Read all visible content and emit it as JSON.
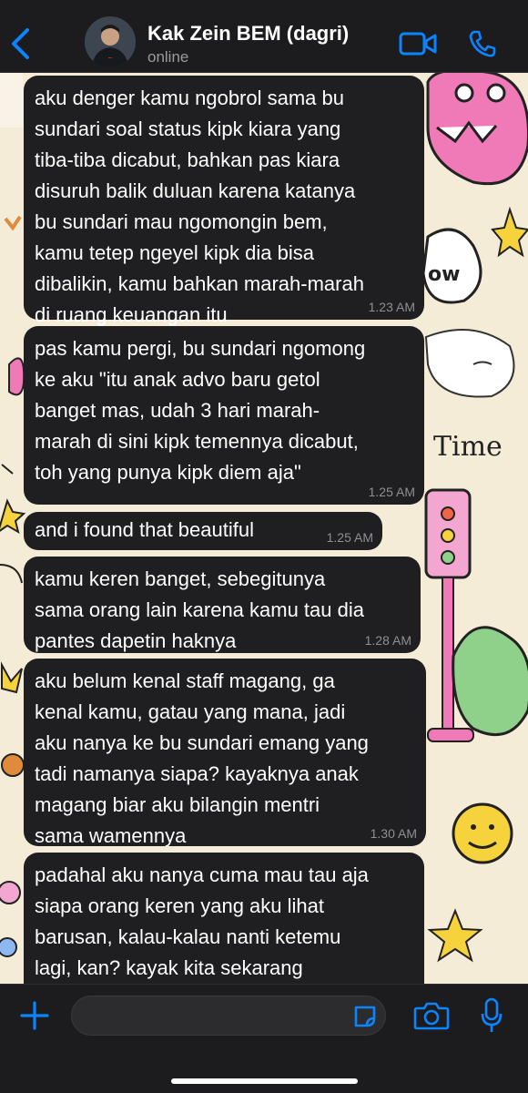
{
  "header": {
    "back_icon": "chevron-left-icon",
    "contact_name": "Kak Zein BEM (dagri)",
    "status": "online",
    "video_icon": "video-camera-icon",
    "phone_icon": "phone-icon",
    "accent": "#0a84ff"
  },
  "messages": [
    {
      "text": "aku denger kamu ngobrol sama bu\nsundari soal status kipk kiara yang\ntiba-tiba dicabut, bahkan pas kiara\ndisuruh balik duluan karena katanya\nbu sundari mau ngomongin bem,\nkamu tetep ngeyel kipk dia bisa\ndibalikin, kamu bahkan marah-marah\ndi ruang keuangan itu",
      "time": "1.23 AM"
    },
    {
      "text": "pas kamu pergi, bu sundari ngomong\nke aku \"itu anak advo baru getol\nbanget mas, udah 3 hari marah-\nmarah di sini kipk temennya dicabut,\ntoh yang punya kipk diem aja\"",
      "time": "1.25 AM"
    },
    {
      "text": "and i found that beautiful",
      "time": "1.25 AM"
    },
    {
      "text": "kamu keren banget, sebegitunya\nsama orang lain karena kamu tau dia\npantes dapetin haknya",
      "time": "1.28 AM"
    },
    {
      "text": "aku belum kenal staff magang, ga\nkenal kamu, gatau yang mana, jadi\naku nanya ke bu sundari emang yang\ntadi namanya siapa? kayaknya anak\nmagang biar aku bilangin mentri\nsama wamennya",
      "time": "1.30 AM"
    },
    {
      "text": "padahal aku nanya cuma mau tau aja\nsiapa orang keren yang aku lihat\nbarusan, kalau-kalau nanti ketemu\nlagi, kan? kayak kita sekarang",
      "time": ""
    }
  ],
  "wallpaper": {
    "label": "Time",
    "speech_text": "ow",
    "colors": {
      "background": "#f4ecd6",
      "pink": "#f07ab8",
      "yellow": "#f6d23c",
      "green": "#8fd08a"
    }
  },
  "composer": {
    "plus_icon": "plus-icon",
    "input_value": "",
    "sticker_icon": "sticker-icon",
    "camera_icon": "camera-icon",
    "mic_icon": "microphone-icon"
  }
}
